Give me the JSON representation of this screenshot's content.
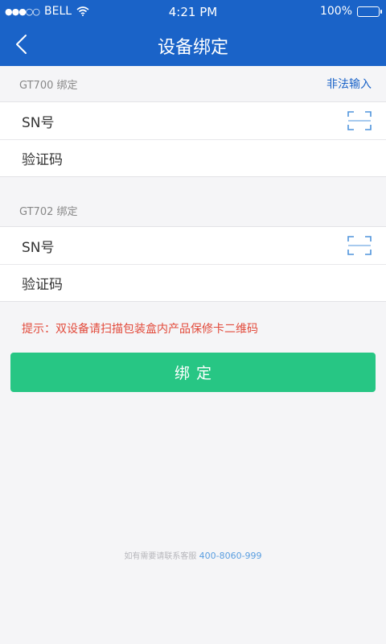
{
  "status_bar": {
    "signal": "●●●○○",
    "carrier": "BELL",
    "time": "4:21 PM",
    "battery": "100%"
  },
  "header": {
    "title": "设备绑定",
    "back_icon": "chevron-left-icon"
  },
  "sections": [
    {
      "title": "GT700 绑定",
      "link": "非法输入",
      "rows": [
        {
          "label": "SN号",
          "icon": "scan-icon"
        },
        {
          "label": "验证码"
        }
      ]
    },
    {
      "title": "GT702 绑定",
      "rows": [
        {
          "label": "SN号",
          "icon": "scan-icon"
        },
        {
          "label": "验证码"
        }
      ]
    }
  ],
  "hint": "提示：双设备请扫描包装盒内产品保修卡二维码",
  "bind_button": "绑定",
  "footer": {
    "text": "如有需要请联系客服",
    "phone": "400-8060-999"
  },
  "colors": {
    "header": "#1a63c8",
    "button": "#27c684",
    "hint": "#e24a3b",
    "link": "#1a63c8",
    "footer_phone": "#5a9ee0"
  }
}
